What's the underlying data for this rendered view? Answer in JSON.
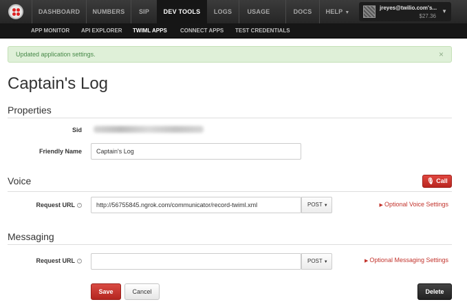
{
  "nav": {
    "items": [
      {
        "label": "DASHBOARD",
        "active": false
      },
      {
        "label": "NUMBERS",
        "active": false
      },
      {
        "label": "SIP",
        "active": false
      },
      {
        "label": "DEV TOOLS",
        "active": true
      },
      {
        "label": "LOGS",
        "active": false
      },
      {
        "label": "USAGE",
        "active": false
      },
      {
        "label": "DOCS",
        "active": false
      },
      {
        "label": "HELP",
        "active": false
      }
    ],
    "account": {
      "email": "jreyes@twilio.com's...",
      "balance": "$27.36"
    }
  },
  "subnav": {
    "items": [
      {
        "label": "APP MONITOR",
        "active": false
      },
      {
        "label": "API EXPLORER",
        "active": false
      },
      {
        "label": "TWIML APPS",
        "active": true
      },
      {
        "label": "CONNECT APPS",
        "active": false
      },
      {
        "label": "TEST CREDENTIALS",
        "active": false
      }
    ]
  },
  "alert": {
    "message": "Updated application settings.",
    "close": "×"
  },
  "page": {
    "title": "Captain's Log"
  },
  "properties": {
    "section_title": "Properties",
    "sid_label": "Sid",
    "friendly_name_label": "Friendly Name",
    "friendly_name_value": "Captain's Log"
  },
  "voice": {
    "section_title": "Voice",
    "call_button": "Call",
    "request_url_label": "Request URL",
    "request_url_value": "http://56755845.ngrok.com/communicator/record-twiml.xml",
    "method": "POST",
    "optional_link": "Optional Voice Settings"
  },
  "messaging": {
    "section_title": "Messaging",
    "request_url_label": "Request URL",
    "request_url_value": "",
    "method": "POST",
    "optional_link": "Optional Messaging Settings"
  },
  "actions": {
    "save": "Save",
    "cancel": "Cancel",
    "delete": "Delete"
  },
  "colors": {
    "accent_red": "#c2322b",
    "nav_dark": "#262626",
    "success_bg": "#dff0d8"
  }
}
